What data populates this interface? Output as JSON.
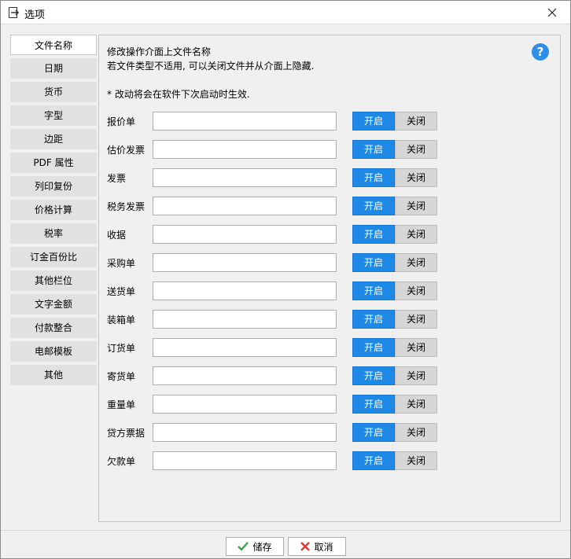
{
  "window": {
    "title": "选项"
  },
  "sidebar": {
    "items": [
      {
        "label": "文件名称",
        "active": true
      },
      {
        "label": "日期"
      },
      {
        "label": "货币"
      },
      {
        "label": "字型"
      },
      {
        "label": "边距"
      },
      {
        "label": "PDF 属性"
      },
      {
        "label": "列印复份"
      },
      {
        "label": "价格计算"
      },
      {
        "label": "税率"
      },
      {
        "label": "订金百份比"
      },
      {
        "label": "其他栏位"
      },
      {
        "label": "文字金额"
      },
      {
        "label": "付款整合"
      },
      {
        "label": "电邮模板"
      },
      {
        "label": "其他"
      }
    ]
  },
  "panel": {
    "description_line1": "修改操作介面上文件名称",
    "description_line2": "若文件类型不适用, 可以关闭文件并从介面上隐藏.",
    "note": "* 改动将会在软件下次启动时生效.",
    "help_icon": "?",
    "on_label": "开启",
    "off_label": "关闭",
    "rows": [
      {
        "label": "报价单",
        "value": ""
      },
      {
        "label": "估价发票",
        "value": ""
      },
      {
        "label": "发票",
        "value": ""
      },
      {
        "label": "税务发票",
        "value": ""
      },
      {
        "label": "收据",
        "value": ""
      },
      {
        "label": "采购单",
        "value": ""
      },
      {
        "label": "送货单",
        "value": ""
      },
      {
        "label": "装箱单",
        "value": ""
      },
      {
        "label": "订货单",
        "value": ""
      },
      {
        "label": "寄货单",
        "value": ""
      },
      {
        "label": "重量单",
        "value": ""
      },
      {
        "label": "贷方票据",
        "value": ""
      },
      {
        "label": "欠款单",
        "value": ""
      }
    ]
  },
  "footer": {
    "save_label": "储存",
    "cancel_label": "取消"
  },
  "colors": {
    "accent": "#1e88e5",
    "help": "#2f8ee6",
    "save_check": "#3aa84a",
    "cancel_x": "#e53935"
  }
}
